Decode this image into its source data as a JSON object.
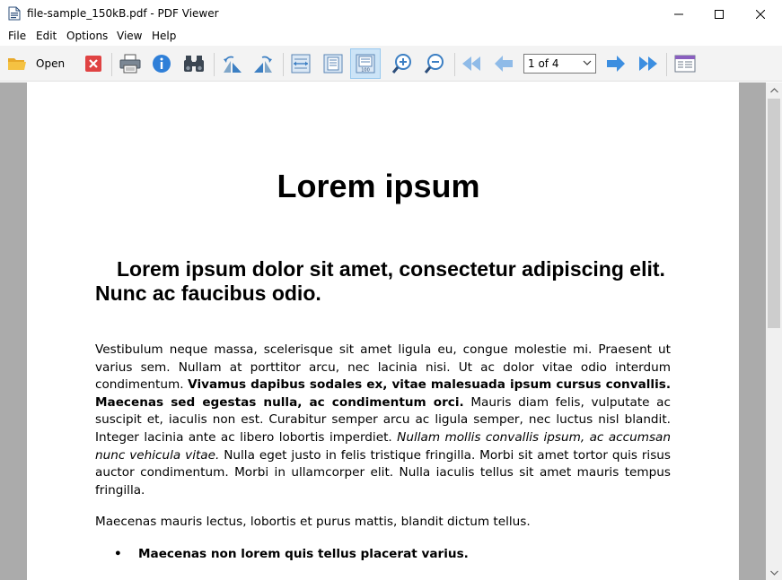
{
  "window": {
    "title": "file-sample_150kB.pdf - PDF Viewer"
  },
  "menu": {
    "file": "File",
    "edit": "Edit",
    "options": "Options",
    "view": "View",
    "help": "Help"
  },
  "toolbar": {
    "open_label": "Open",
    "page_select_value": "1 of 4",
    "icons": [
      "open-folder-icon",
      "close-document-icon",
      "print-icon",
      "info-icon",
      "find-binoculars-icon",
      "rotate-left-icon",
      "rotate-right-icon",
      "fit-width-icon",
      "fit-page-icon",
      "actual-size-icon",
      "zoom-in-icon",
      "zoom-out-icon",
      "first-page-icon",
      "previous-page-icon",
      "next-page-icon",
      "last-page-icon",
      "sidebar-toggle-icon"
    ]
  },
  "document": {
    "title": "Lorem ipsum",
    "subtitle": "Lorem ipsum dolor sit amet, consectetur adipiscing elit. Nunc ac faucibus odio.",
    "para1": {
      "t1": "Vestibulum neque massa, scelerisque sit amet ligula eu, congue molestie mi. Praesent ut varius sem. Nullam at porttitor arcu, nec lacinia nisi. Ut ac dolor vitae odio interdum condimentum. ",
      "bold": "Vivamus dapibus sodales ex, vitae malesuada ipsum cursus convallis. Maecenas sed egestas nulla, ac condimentum orci.",
      "t2": " Mauris diam felis, vulputate ac suscipit et, iaculis non est. Curabitur semper arcu ac ligula semper, nec luctus nisl blandit. Integer lacinia ante ac libero lobortis imperdiet. ",
      "italic": "Nullam mollis convallis ipsum, ac accumsan nunc vehicula vitae.",
      "t3": " Nulla eget justo in felis tristique fringilla. Morbi sit amet tortor quis risus auctor condimentum. Morbi in ullamcorper elit. Nulla iaculis tellus sit amet mauris tempus fringilla."
    },
    "para2": "Maecenas mauris lectus, lobortis et purus mattis, blandit dictum tellus.",
    "bullet1": "Maecenas non lorem quis tellus placerat varius.",
    "bullet_symbol": "•"
  },
  "colors": {
    "nav_blue": "#3c8ee0",
    "nav_blue_light": "#8fbbe8",
    "close_red": "#e04343",
    "toolbar_bg": "#f3f3f3",
    "viewport_bg": "#ababab"
  }
}
